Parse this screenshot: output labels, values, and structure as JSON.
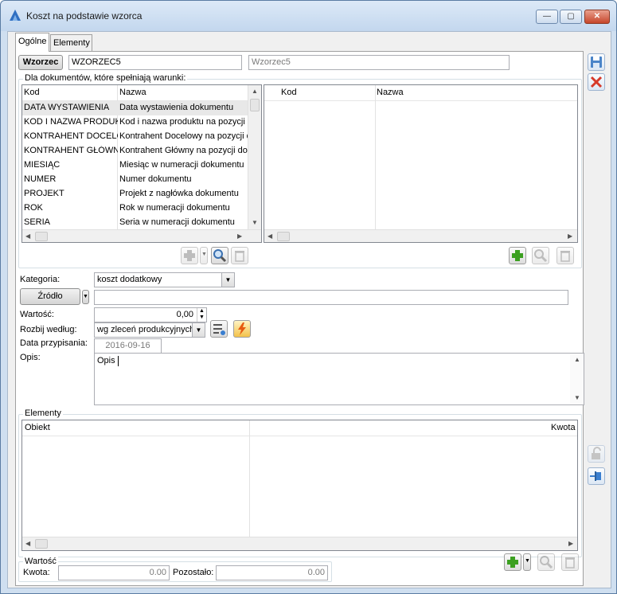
{
  "window": {
    "title": "Koszt na podstawie wzorca",
    "minimize": "—",
    "maximize": "▢",
    "close": "✕"
  },
  "tabs": [
    {
      "label": "Ogólne"
    },
    {
      "label": "Elementy"
    }
  ],
  "header": {
    "wzorzec_button": "Wzorzec",
    "wzorzec_code": "WZORZEC5",
    "wzorzec_name": "Wzorzec5"
  },
  "conditions": {
    "label": "Dla dokumentów, które spełniają warunki:",
    "left_columns": {
      "kod": "Kod",
      "nazwa": "Nazwa"
    },
    "right_columns": {
      "kod": "Kod",
      "nazwa": "Nazwa"
    },
    "rows": [
      {
        "kod": "DATA WYSTAWIENIA",
        "nazwa": "Data wystawienia dokumentu"
      },
      {
        "kod": "KOD I NAZWA PRODUKT",
        "nazwa": "Kod i nazwa produktu na pozycji d"
      },
      {
        "kod": "KONTRAHENT DOCELOW",
        "nazwa": "Kontrahent Docelowy na pozycji d"
      },
      {
        "kod": "KONTRAHENT GŁÓWNY",
        "nazwa": "Kontrahent Główny na pozycji do"
      },
      {
        "kod": "MIESIĄC",
        "nazwa": "Miesiąc w numeracji dokumentu"
      },
      {
        "kod": "NUMER",
        "nazwa": "Numer dokumentu"
      },
      {
        "kod": "PROJEKT",
        "nazwa": "Projekt z nagłówka dokumentu"
      },
      {
        "kod": "ROK",
        "nazwa": "Rok w numeracji dokumentu"
      },
      {
        "kod": "SERIA",
        "nazwa": "Seria w numeracji dokumentu"
      }
    ]
  },
  "form": {
    "kategoria_label": "Kategoria:",
    "kategoria_value": "koszt dodatkowy",
    "zrodlo_button": "Źródło",
    "zrodlo_value": "",
    "wartosc_label": "Wartość:",
    "wartosc_value": "0,00",
    "rozbij_label": "Rozbij według:",
    "rozbij_value": "wg zleceń produkcyjnych",
    "data_label": "Data przypisania:",
    "data_value": "2016-09-16",
    "opis_label": "Opis:",
    "opis_value": "Opis"
  },
  "elementy": {
    "label": "Elementy",
    "col_obiekt": "Obiekt",
    "col_kwota": "Kwota"
  },
  "summary": {
    "label": "Wartość",
    "kwota_label": "Kwota:",
    "kwota_value": "0.00",
    "pozostalo_label": "Pozostało:",
    "pozostalo_value": "0.00"
  },
  "colors": {
    "accent": "#3a7fd0",
    "add_green": "#3ca021",
    "delete_red": "#d63a2a"
  }
}
